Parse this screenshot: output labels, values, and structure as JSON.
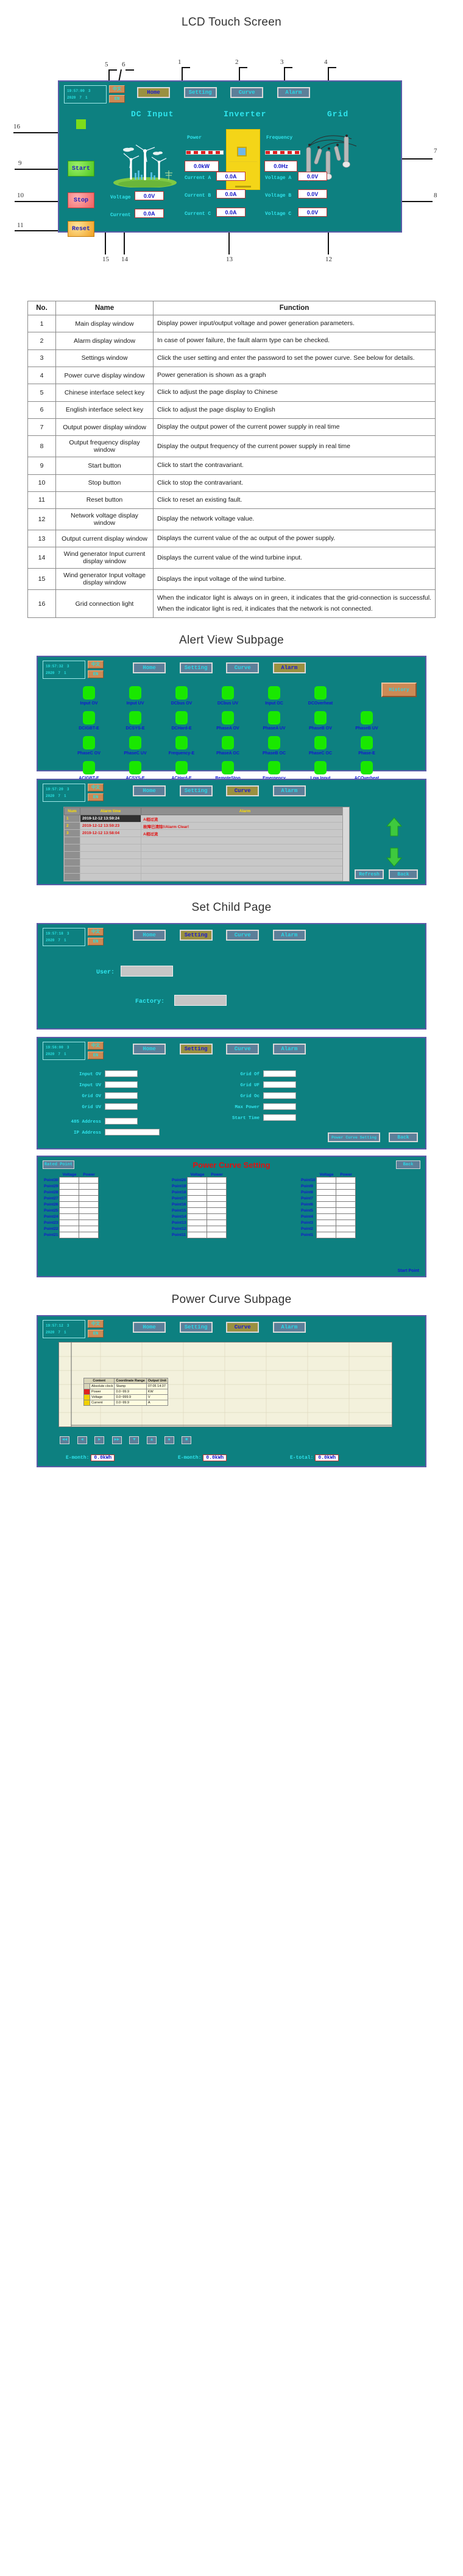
{
  "sections": {
    "main_title": "LCD Touch Screen",
    "alert_title": "Alert View Subpage",
    "set_title": "Set Child Page",
    "curve_title": "Power Curve Subpage"
  },
  "hmi_common": {
    "clock_time": "19:57:00",
    "clock_weekday": "3",
    "clock_year": "2020",
    "clock_month": "7",
    "clock_day": "1",
    "lang_cn": "中文",
    "lang_en": "EN",
    "nav": [
      {
        "label": "Home"
      },
      {
        "label": "Setting"
      },
      {
        "label": "Curve"
      },
      {
        "label": "Alarm"
      }
    ]
  },
  "main_screen": {
    "active_nav": "Home",
    "headers": {
      "dc": "DC Input",
      "inverter": "Inverter",
      "grid": "Grid"
    },
    "power_label": "Power",
    "power_value": "0.0kW",
    "frequency_label": "Frequency",
    "frequency_value": "0.0Hz",
    "buttons": {
      "start": "Start",
      "stop": "Stop",
      "reset": "Reset"
    },
    "dc_fields": [
      {
        "label": "Voltage",
        "value": "0.0V"
      },
      {
        "label": "Current",
        "value": "0.0A"
      }
    ],
    "ac_current": [
      {
        "label": "Current A",
        "value": "0.0A"
      },
      {
        "label": "Current B",
        "value": "0.0A"
      },
      {
        "label": "Current C",
        "value": "0.0A"
      }
    ],
    "ac_voltage": [
      {
        "label": "Voltage A",
        "value": "0.0V"
      },
      {
        "label": "Voltage B",
        "value": "0.0V"
      },
      {
        "label": "Voltage C",
        "value": "0.0V"
      }
    ],
    "callouts": [
      "1",
      "2",
      "3",
      "4",
      "5",
      "6",
      "7",
      "8",
      "9",
      "10",
      "11",
      "12",
      "13",
      "14",
      "15",
      "16"
    ]
  },
  "spec_table": {
    "headers": [
      "No.",
      "Name",
      "Function"
    ],
    "rows": [
      {
        "no": "1",
        "name": "Main display window",
        "fn": "Display power input/output voltage and power generation parameters."
      },
      {
        "no": "2",
        "name": "Alarm display window",
        "fn": "In case of power failure, the fault alarm type can be checked."
      },
      {
        "no": "3",
        "name": "Settings window",
        "fn": "Click the user setting and enter the password to set the power curve. See below for details."
      },
      {
        "no": "4",
        "name": "Power curve display window",
        "fn": "Power generation is shown as a graph"
      },
      {
        "no": "5",
        "name": "Chinese interface select key",
        "fn": "Click to adjust the page display to Chinese"
      },
      {
        "no": "6",
        "name": "English interface select key",
        "fn": "Click to adjust the page display to English"
      },
      {
        "no": "7",
        "name": "Output power display window",
        "fn": "Display the output power of the current power supply in real time"
      },
      {
        "no": "8",
        "name": "Output frequency display window",
        "fn": "Display the output frequency of the current power supply in real time"
      },
      {
        "no": "9",
        "name": "Start button",
        "fn": "Click to start the contravariant."
      },
      {
        "no": "10",
        "name": "Stop button",
        "fn": "Click to stop the contravariant."
      },
      {
        "no": "11",
        "name": "Reset button",
        "fn": "Click to reset an existing fault."
      },
      {
        "no": "12",
        "name": "Network voltage display window",
        "fn": "Display the network voltage value."
      },
      {
        "no": "13",
        "name": "Output current display window",
        "fn": "Displays the current value of the ac output of the power supply."
      },
      {
        "no": "14",
        "name": "Wind generator Input current display window",
        "fn": "Displays the current value of the wind turbine input."
      },
      {
        "no": "15",
        "name": "Wind generator Input voltage display window",
        "fn": "Displays the input voltage of the wind turbine."
      },
      {
        "no": "16",
        "name": "Grid connection light",
        "fn": "When the indicator light is always on in green, it indicates that the grid-connection is successful. When the indicator light is red, it indicates that the network is not connected."
      }
    ]
  },
  "alarm_screen": {
    "clock_time": "19:57:32",
    "active_nav": "Alarm",
    "history_button": "History",
    "leds": [
      [
        "Input OV",
        "Input UV",
        "DCbus OV",
        "DCbus UV",
        "Input OC",
        "DCOverheat"
      ],
      [
        "DCIGBT-E",
        "DCSYS-E",
        "DCHard-E",
        "PhaseA OV",
        "PhaseA UV",
        "PhaseB OV",
        "PhaseB UV"
      ],
      [
        "PhaseC OV",
        "PhaseC UV",
        "Frequency-E",
        "PhaseA OC",
        "PhaseB OC",
        "PhaseC OC",
        "Phase-E"
      ],
      [
        "ACIGBT-E",
        "ACSYS-E",
        "ACHard-E",
        "RemoteStop",
        "Emergency",
        "Low Input",
        "ACOverheat"
      ]
    ],
    "led_color": "#19e800"
  },
  "history_screen": {
    "clock_time": "19:57:20",
    "active_nav": "Curve",
    "headers": [
      "Num",
      "Alarm time",
      "Alarm"
    ],
    "rows": [
      {
        "num": "1",
        "time": "2019-12-12 13:59:24",
        "alarm": "A相过流"
      },
      {
        "num": "2",
        "time": "2019-12-12 13:59:23",
        "alarm": "故障已清除!/Alarm Clear!"
      },
      {
        "num": "3",
        "time": "2019-12-12 13:58:04",
        "alarm": "A相过流"
      }
    ],
    "empty_rows": 6,
    "refresh_button": "Refresh",
    "back_button": "Back"
  },
  "user_screen": {
    "clock_time": "19:57:18",
    "active_nav": "Setting",
    "user_label": "User:",
    "user_value": "",
    "factory_label": "Factory:",
    "factory_value": ""
  },
  "param_screen": {
    "clock_time": "19:56:00",
    "active_nav": "Setting",
    "left_fields": [
      {
        "label": "Input OV",
        "value": ""
      },
      {
        "label": "Input UV",
        "value": ""
      },
      {
        "label": "Grid OV",
        "value": ""
      },
      {
        "label": "Grid UV",
        "value": ""
      }
    ],
    "right_fields": [
      {
        "label": "Grid Of",
        "value": ""
      },
      {
        "label": "Grid UF",
        "value": ""
      },
      {
        "label": "Grid Oc",
        "value": ""
      },
      {
        "label": "Max Power",
        "value": ""
      },
      {
        "label": "Start Time",
        "value": ""
      }
    ],
    "bottom_fields": [
      {
        "label": "485 Address",
        "value": ""
      },
      {
        "label": "IP Address",
        "value": ""
      }
    ],
    "power_curve_button": "Power Curve Setting",
    "back_button": "Back"
  },
  "curve_setting_screen": {
    "title": "Power Curve Setting",
    "rated_point_button": "Rated Point",
    "back_button": "Back",
    "start_point_label": "Start Point",
    "col_headers": [
      "Voltage",
      "Power"
    ],
    "col1_points": [
      "Point30",
      "Point29",
      "Point28",
      "Point27",
      "Point26",
      "Point25",
      "Point24",
      "Point23",
      "Point22",
      "Point21"
    ],
    "col2_points": [
      "Point20",
      "Point19",
      "Point18",
      "Point17",
      "Point16",
      "Point15",
      "Point14",
      "Point13",
      "Point12",
      "Point11"
    ],
    "col3_points": [
      "Point10",
      "Point9",
      "Point8",
      "Point7",
      "Point6",
      "Point5",
      "Point4",
      "Point3",
      "Point2",
      "Point1"
    ]
  },
  "curve_screen": {
    "clock_time": "19:57:12",
    "active_nav": "Curve",
    "legend_headers": [
      "Content",
      "Coordinate Range",
      "Output Unit"
    ],
    "legend_rows": [
      {
        "content": "Absolute clock",
        "range": "Stamp",
        "unit": "07:05 14:37"
      },
      {
        "content": "Power",
        "range": "0.0~99.9",
        "unit": "KW"
      },
      {
        "content": "Voltage",
        "range": "0.0~999.9",
        "unit": "V"
      },
      {
        "content": "Current",
        "range": "0.0~99.9",
        "unit": "A"
      }
    ],
    "nav_buttons": [
      "◀◀",
      "◀",
      "▶",
      "▶▶",
      "▼",
      "▲",
      "◆",
      "■"
    ],
    "totals": [
      {
        "label": "E-month:",
        "value": "0.0kWh"
      },
      {
        "label": "E-month:",
        "value": "0.0kWh"
      },
      {
        "label": "E-total:",
        "value": "0.0kWh"
      }
    ]
  },
  "chart_data": {
    "type": "line",
    "title": "Power Curve",
    "xlabel": "Absolute clock",
    "ylabel": "",
    "x": [
      "07:05",
      "14:37"
    ],
    "series": [
      {
        "name": "Power",
        "unit": "KW",
        "range": [
          0.0,
          99.9
        ],
        "values": [
          0.0,
          0.0
        ]
      },
      {
        "name": "Voltage",
        "unit": "V",
        "range": [
          0.0,
          999.9
        ],
        "values": [
          0.0,
          0.0
        ]
      },
      {
        "name": "Current",
        "unit": "A",
        "range": [
          0.0,
          99.9
        ],
        "values": [
          0.0,
          0.0
        ]
      }
    ],
    "grid": true,
    "legend": "inside-top-left"
  },
  "colors": {
    "hmi_bg": "#0d8080",
    "hmi_border": "#5b5ba8",
    "cyan_text": "#2fe6ef",
    "blue_text": "#1414d2",
    "nav_button": "#5c7f99",
    "nav_active": "#9a9040",
    "lang_button": "#cc8a55",
    "led_green": "#19e800",
    "inverter_yellow": "#f4d518",
    "start_green": "#4ec820",
    "stop_red": "#f06060",
    "reset_orange": "#f0a020"
  }
}
